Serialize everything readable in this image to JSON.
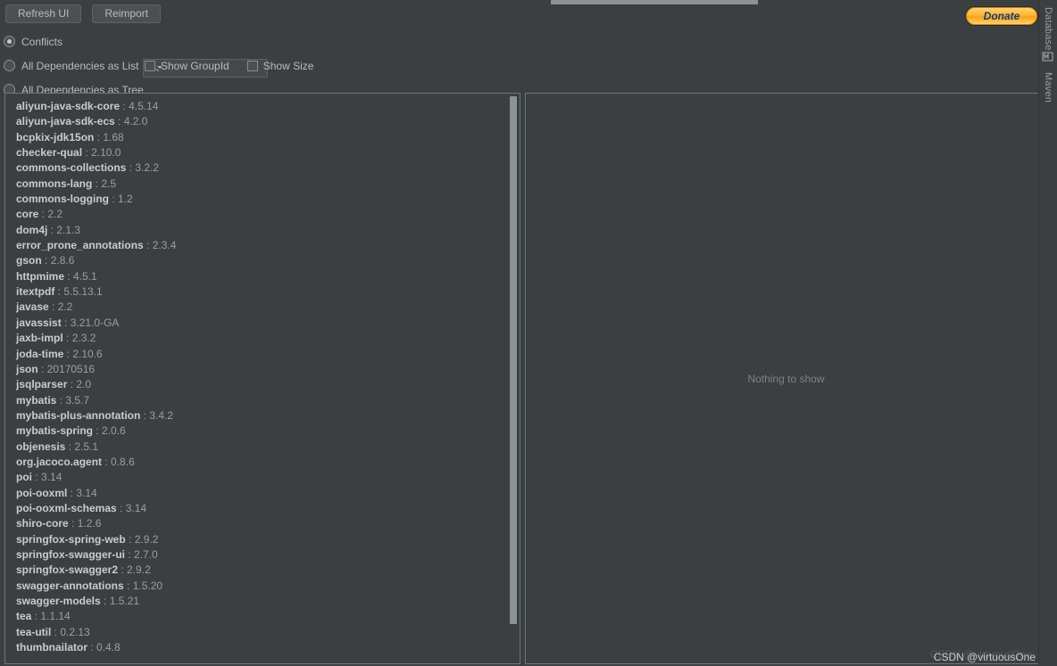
{
  "colors": {
    "background": "#3c3f41",
    "panel_border": "#6b757e",
    "text_primary": "#c8ccd0",
    "text_secondary": "#9a9fa3",
    "donate_accent": "#fdb530",
    "donate_text": "#143c78",
    "scrollbar": "#8c9196"
  },
  "toolbar": {
    "refresh_label": "Refresh UI",
    "reimport_label": "Reimport",
    "donate_label": "Donate"
  },
  "search": {
    "value": "",
    "placeholder": "",
    "icon": "search-icon"
  },
  "options": {
    "radios": [
      {
        "label": "Conflicts",
        "checked": true
      },
      {
        "label": "All Dependencies as List",
        "checked": false
      },
      {
        "label": "All Dependencies as Tree",
        "checked": false
      }
    ],
    "checkboxes": [
      {
        "label": "Show GroupId",
        "checked": false
      },
      {
        "label": "Show Size",
        "checked": false
      }
    ]
  },
  "dependencies": [
    {
      "name": "aliyun-java-sdk-core",
      "version": "4.5.14"
    },
    {
      "name": "aliyun-java-sdk-ecs",
      "version": "4.2.0"
    },
    {
      "name": "bcpkix-jdk15on",
      "version": "1.68"
    },
    {
      "name": "checker-qual",
      "version": "2.10.0"
    },
    {
      "name": "commons-collections",
      "version": "3.2.2"
    },
    {
      "name": "commons-lang",
      "version": "2.5"
    },
    {
      "name": "commons-logging",
      "version": "1.2"
    },
    {
      "name": "core",
      "version": "2.2"
    },
    {
      "name": "dom4j",
      "version": "2.1.3"
    },
    {
      "name": "error_prone_annotations",
      "version": "2.3.4"
    },
    {
      "name": "gson",
      "version": "2.8.6"
    },
    {
      "name": "httpmime",
      "version": "4.5.1"
    },
    {
      "name": "itextpdf",
      "version": "5.5.13.1"
    },
    {
      "name": "javase",
      "version": "2.2"
    },
    {
      "name": "javassist",
      "version": "3.21.0-GA"
    },
    {
      "name": "jaxb-impl",
      "version": "2.3.2"
    },
    {
      "name": "joda-time",
      "version": "2.10.6"
    },
    {
      "name": "json",
      "version": "20170516"
    },
    {
      "name": "jsqlparser",
      "version": "2.0"
    },
    {
      "name": "mybatis",
      "version": "3.5.7"
    },
    {
      "name": "mybatis-plus-annotation",
      "version": "3.4.2"
    },
    {
      "name": "mybatis-spring",
      "version": "2.0.6"
    },
    {
      "name": "objenesis",
      "version": "2.5.1"
    },
    {
      "name": "org.jacoco.agent",
      "version": "0.8.6"
    },
    {
      "name": "poi",
      "version": "3.14"
    },
    {
      "name": "poi-ooxml",
      "version": "3.14"
    },
    {
      "name": "poi-ooxml-schemas",
      "version": "3.14"
    },
    {
      "name": "shiro-core",
      "version": "1.2.6"
    },
    {
      "name": "springfox-spring-web",
      "version": "2.9.2"
    },
    {
      "name": "springfox-swagger-ui",
      "version": "2.7.0"
    },
    {
      "name": "springfox-swagger2",
      "version": "2.9.2"
    },
    {
      "name": "swagger-annotations",
      "version": "1.5.20"
    },
    {
      "name": "swagger-models",
      "version": "1.5.21"
    },
    {
      "name": "tea",
      "version": "1.1.14"
    },
    {
      "name": "tea-util",
      "version": "0.2.13"
    },
    {
      "name": "thumbnailator",
      "version": "0.4.8"
    }
  ],
  "separator": " : ",
  "detail_panel": {
    "empty_text": "Nothing to show"
  },
  "tool_stripe": {
    "database_label": "Database",
    "maven_label": "Maven",
    "maven_icon": "maven-icon"
  },
  "watermark": {
    "text": "CSDN @virtuousOne"
  }
}
